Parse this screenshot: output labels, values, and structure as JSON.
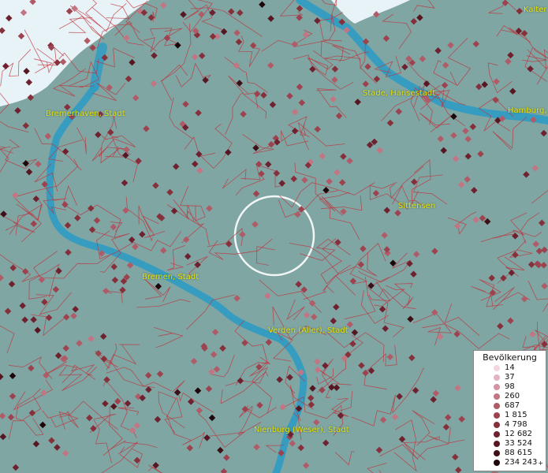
{
  "map": {
    "labels": {
      "bremerhaven": "Bremerhaven, Stadt",
      "stade": "Stade, Hansestadt",
      "hamburg": "Hamburg,",
      "kalte": "Kalter",
      "sittensen": "Sittensen",
      "bremen": "Bremen, Stadt",
      "verden": "Verden (Aller), Stadt",
      "nienburg": "Nienburg (Weser), Stadt"
    },
    "colors": {
      "land": "#7fa6a3",
      "water": "#2f9cc4",
      "sea": "#e8f3f7",
      "borders": "#c0303a",
      "label": "#e8e000"
    }
  },
  "legend": {
    "title": "Bevölkerung",
    "plus": "+",
    "items": [
      {
        "value": "14",
        "color": "#f3d6e0"
      },
      {
        "value": "37",
        "color": "#e3b3c0"
      },
      {
        "value": "98",
        "color": "#d394a3"
      },
      {
        "value": "260",
        "color": "#c27684"
      },
      {
        "value": "687",
        "color": "#b05b68"
      },
      {
        "value": "1 815",
        "color": "#9c434f"
      },
      {
        "value": "4 798",
        "color": "#86303c"
      },
      {
        "value": "12 682",
        "color": "#6e2230"
      },
      {
        "value": "33 524",
        "color": "#561722"
      },
      {
        "value": "88 615",
        "color": "#3d0f17"
      },
      {
        "value": "234 243",
        "color": "#1e070b"
      }
    ]
  }
}
